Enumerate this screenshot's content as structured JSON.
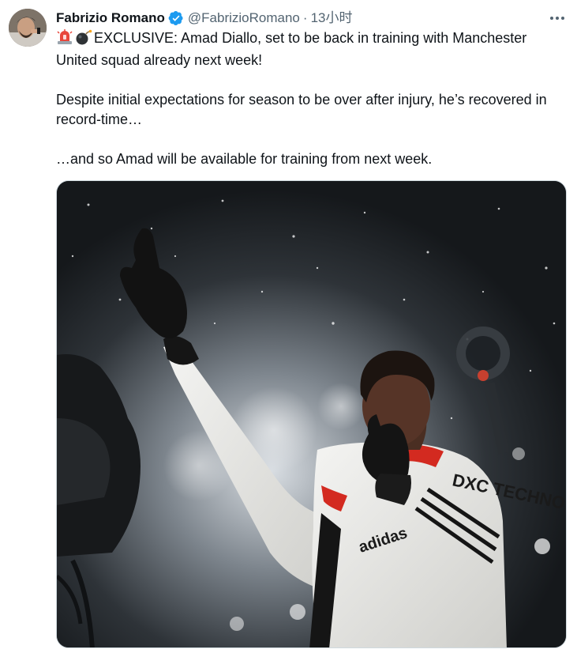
{
  "author": {
    "display_name": "Fabrizio Romano",
    "handle": "@FabrizioRomano",
    "separator": "·",
    "timestamp": "13小时",
    "verified": true,
    "verified_color": "#1d9bf0"
  },
  "tweet": {
    "emojis": [
      "rotating-light-emoji",
      "bomb-emoji"
    ],
    "line1": "EXCLUSIVE: Amad Diallo, set to be back in training with Manchester United squad already next week!",
    "line2": "Despite initial expectations for season to be over after injury, he’s recovered in record-time…",
    "line3": "…and so Amad will be available for training from next week."
  },
  "media": {
    "kit_sponsor_text": "DXC TECHNOLOGY",
    "kit_brand_text": "adidas"
  },
  "colors": {
    "text_primary": "#0f1419",
    "text_secondary": "#536471",
    "border": "#cfd9de"
  }
}
